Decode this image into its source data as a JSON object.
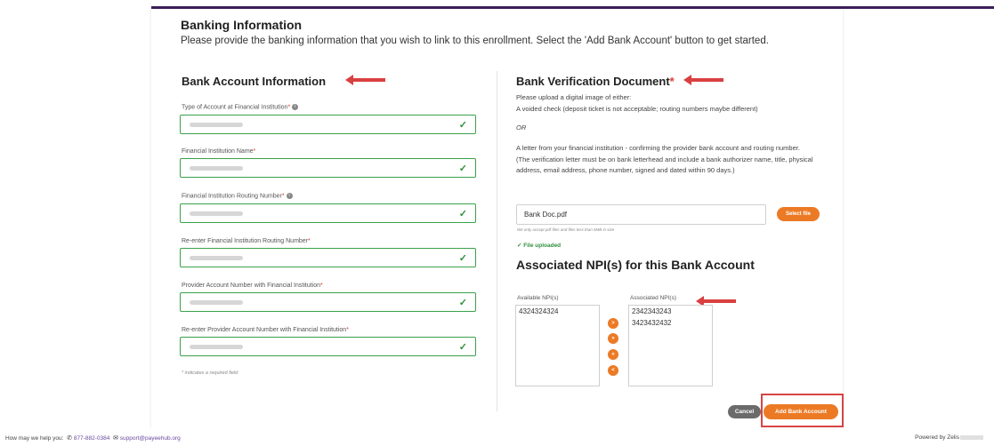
{
  "banking": {
    "title": "Banking Information",
    "description": "Please provide the banking information that you wish to link to this enrollment. Select the 'Add Bank Account' button to get started."
  },
  "account_info": {
    "title": "Bank Account Information",
    "fields": [
      {
        "label": "Type of Account at Financial Institution",
        "required": "*"
      },
      {
        "label": "Financial Institution Name",
        "required": "*"
      },
      {
        "label": "Financial Institution Routing Number",
        "required": "*"
      },
      {
        "label": "Re-enter Financial Institution Routing Number",
        "required": "*"
      },
      {
        "label": "Provider Account Number with Financial Institution",
        "required": "*"
      },
      {
        "label": "Re-enter Provider Account Number with Financial Institution",
        "required": "*"
      }
    ],
    "required_note": "* indicates a required field"
  },
  "verification": {
    "title": "Bank Verification Document",
    "required": "*",
    "intro": "Please upload a digital image of either:",
    "option1": "A voided check (deposit ticket is not acceptable; routing numbers maybe different)",
    "or": "OR",
    "option2": "A letter from your financial institution - confirming the provider bank account and routing number. (The verification letter must be on bank letterhead and include a bank authorizer name, title, physical address, email address, phone number, signed and dated within 90 days.)",
    "file_name": "Bank Doc.pdf",
    "select_file": "Select file",
    "file_note": "We only accept pdf files and files less than 5MB in size",
    "uploaded": "File uploaded"
  },
  "npi": {
    "title": "Associated NPI(s) for this Bank Account",
    "available_label": "Available NPI(s)",
    "associated_label": "Associated NPI(s)",
    "available": [
      "4324324324"
    ],
    "associated": [
      "2342343243",
      "3423432432"
    ],
    "move_buttons": [
      ">",
      "»",
      "«",
      "<"
    ]
  },
  "actions": {
    "cancel": "Cancel",
    "add": "Add Bank Account"
  },
  "footer": {
    "help": "How may we help you:",
    "phone": "877-882-0384",
    "email": "support@payeehub.org",
    "powered": "Powered by Zelis"
  },
  "colors": {
    "accent": "#ec7a25",
    "valid": "#3aa14a",
    "brand": "#3d1f5c",
    "annotation": "#d94040"
  }
}
